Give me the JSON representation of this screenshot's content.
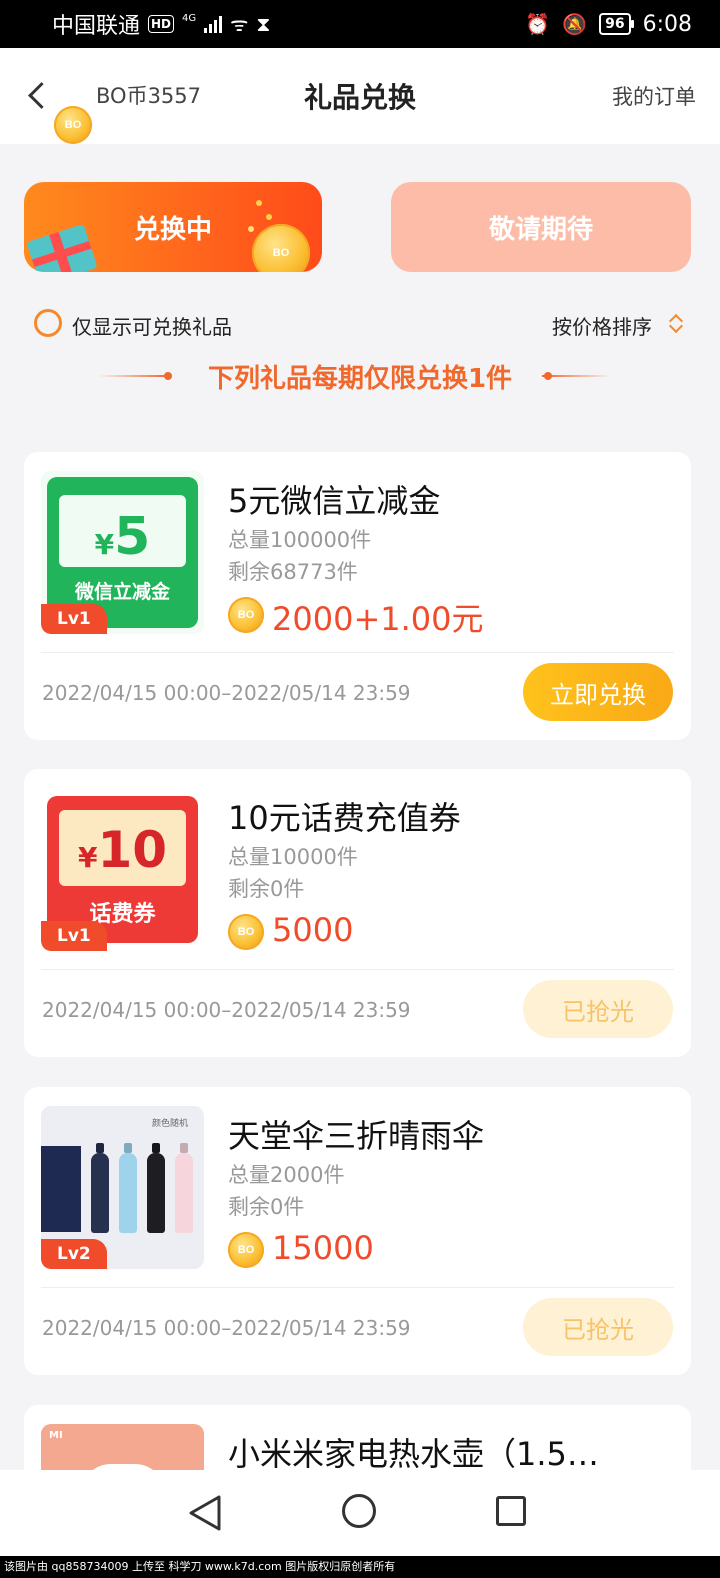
{
  "status_bar": {
    "carrier": "中国联通",
    "hd": "HD",
    "network": "4G",
    "battery": "96",
    "time": "6:08"
  },
  "header": {
    "coin_balance": "BO币3557",
    "title": "礼品兑换",
    "orders_link": "我的订单"
  },
  "tabs": {
    "active": "兑换中",
    "upcoming": "敬请期待"
  },
  "filter": {
    "only_redeemable": "仅显示可兑换礼品",
    "sort": "按价格排序"
  },
  "notice": "下列礼品每期仅限兑换1件",
  "gifts": [
    {
      "name": "5元微信立减金",
      "total": "总量100000件",
      "remaining": "剩余68773件",
      "price": "2000+1.00元",
      "level": "Lv1",
      "period": "2022/04/15 00:00–2022/05/14 23:59",
      "action": "立即兑换",
      "thumb_big": "5",
      "thumb_yen": "¥",
      "thumb_sub": "微信立减金"
    },
    {
      "name": "10元话费充值券",
      "total": "总量10000件",
      "remaining": "剩余0件",
      "price": "5000",
      "level": "Lv1",
      "period": "2022/04/15 00:00–2022/05/14 23:59",
      "action": "已抢光",
      "thumb_big": "10",
      "thumb_yen": "¥",
      "thumb_sub": "话费券"
    },
    {
      "name": "天堂伞三折晴雨伞",
      "total": "总量2000件",
      "remaining": "剩余0件",
      "price": "15000",
      "level": "Lv2",
      "period": "2022/04/15 00:00–2022/05/14 23:59",
      "action": "已抢光",
      "thumb_tag": "颜色随机"
    },
    {
      "name": "小米米家电热水壶（1.5…",
      "thumb_tag": "MI"
    }
  ],
  "footer": "该图片由 qq858734009 上传至 科学刀 www.k7d.com 图片版权归原创者所有"
}
